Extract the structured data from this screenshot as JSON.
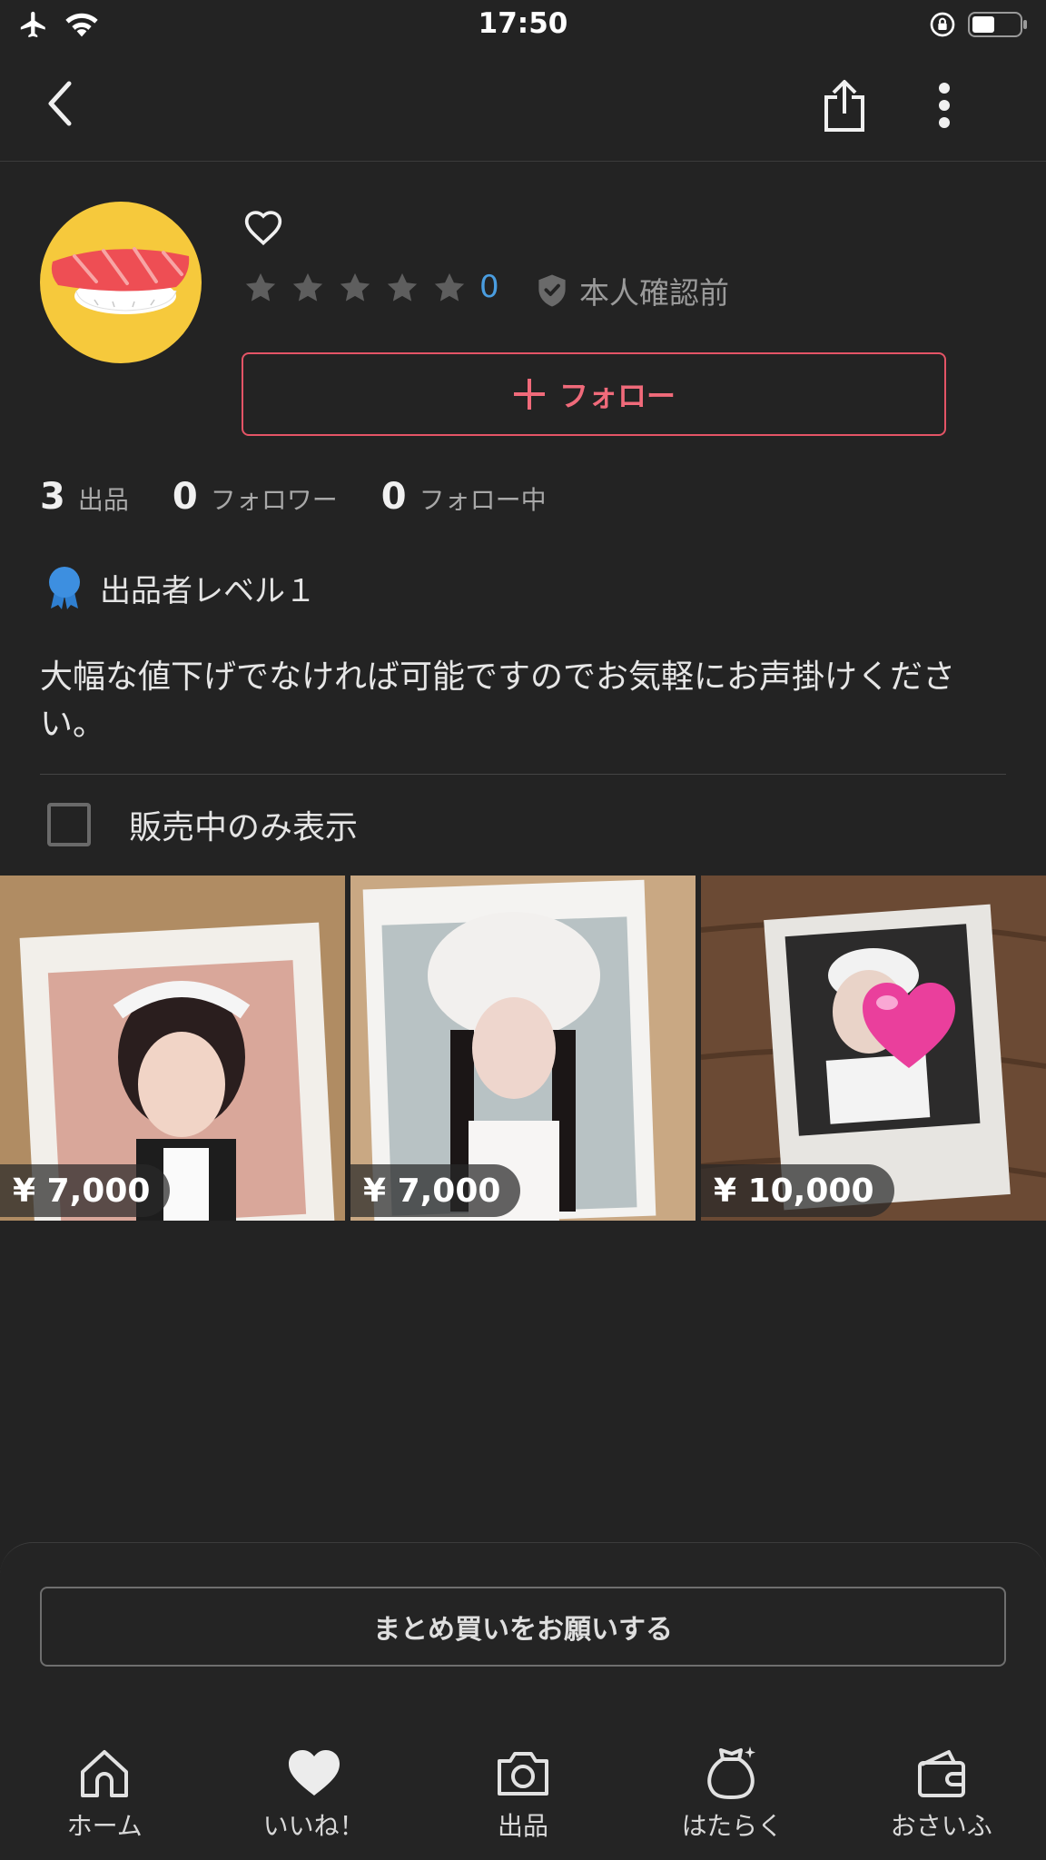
{
  "status_bar": {
    "time": "17:50"
  },
  "profile": {
    "rating_count": "0",
    "verification_label": "本人確認前",
    "follow_label": "フォロー",
    "stats": [
      {
        "value": "3",
        "label": "出品"
      },
      {
        "value": "0",
        "label": "フォロワー"
      },
      {
        "value": "0",
        "label": "フォロー中"
      }
    ],
    "level_label": "出品者レベル１",
    "bio": "大幅な値下げでなければ可能ですのでお気軽にお声掛けください。",
    "star_rating": 0,
    "star_max": 5
  },
  "filter": {
    "label": "販売中のみ表示",
    "checked": false
  },
  "products": [
    {
      "price": "¥ 7,000"
    },
    {
      "price": "¥ 7,000"
    },
    {
      "price": "¥ 10,000"
    }
  ],
  "bulk_buy": {
    "label": "まとめ買いをお願いする"
  },
  "tabs": [
    {
      "label": "ホーム",
      "icon": "home-icon"
    },
    {
      "label": "いいね！",
      "icon": "heart-icon"
    },
    {
      "label": "出品",
      "icon": "camera-icon"
    },
    {
      "label": "はたらく",
      "icon": "money-bag-icon"
    },
    {
      "label": "おさいふ",
      "icon": "wallet-icon"
    }
  ],
  "colors": {
    "background": "#232323",
    "accent_red": "#e45466",
    "rating_blue": "#4a9de0",
    "avatar_yellow": "#f6c93c",
    "level_badge_blue": "#3d8fe0"
  }
}
